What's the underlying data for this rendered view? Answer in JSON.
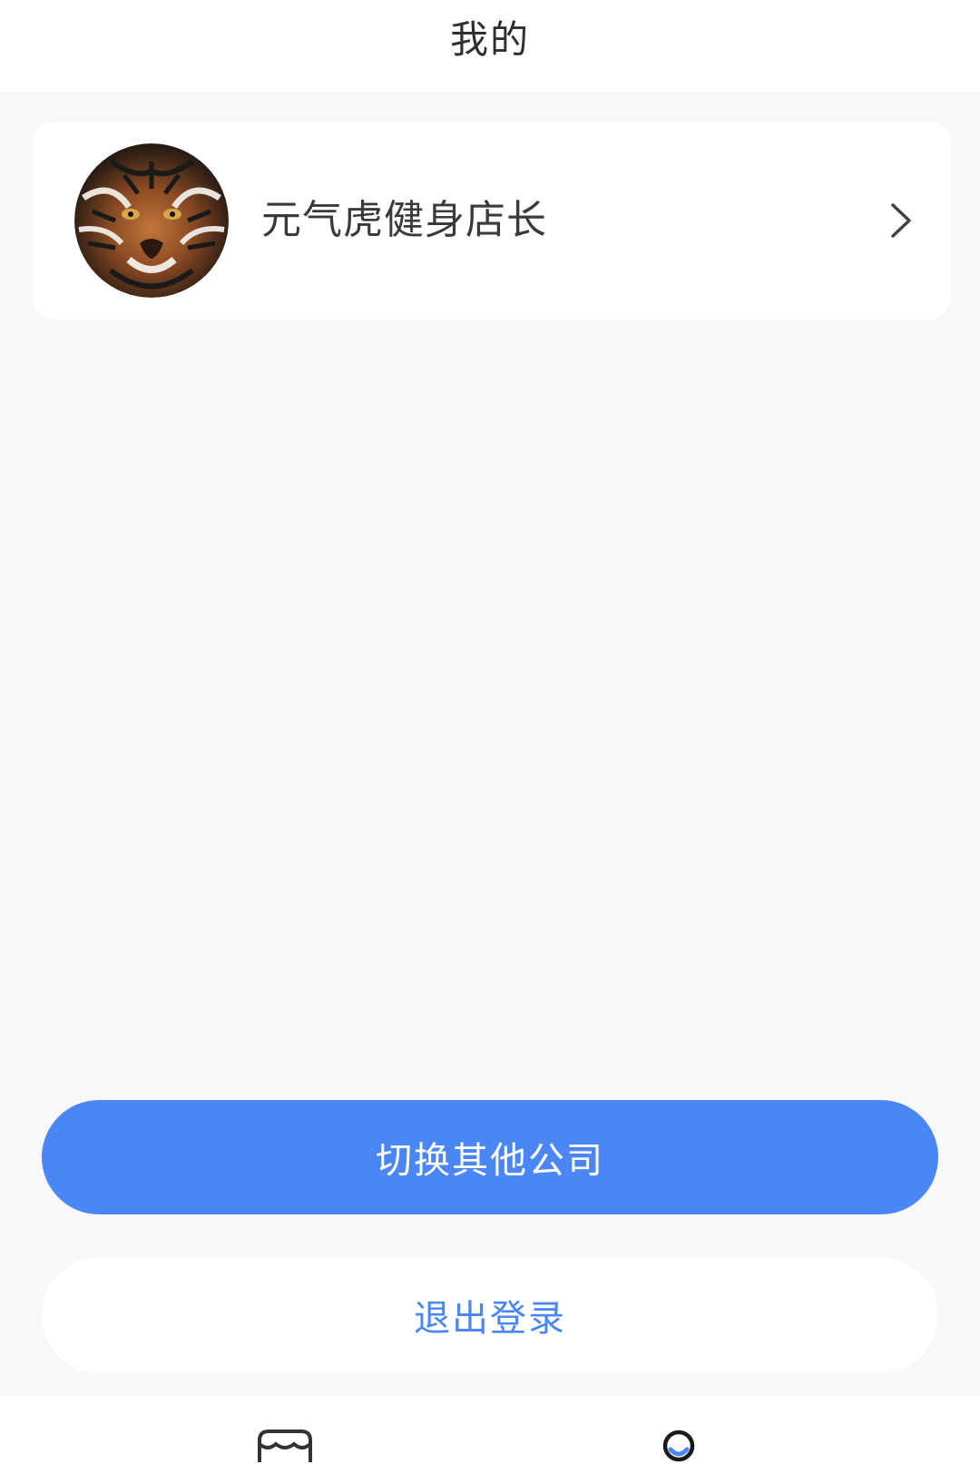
{
  "header": {
    "title": "我的"
  },
  "profile": {
    "name": "元气虎健身店长",
    "avatar_icon": "tiger-avatar",
    "chevron_icon": "chevron-right-icon"
  },
  "actions": {
    "switch_company": "切换其他公司",
    "logout": "退出登录"
  },
  "tabbar": {
    "items": [
      {
        "icon": "store-icon",
        "active": false
      },
      {
        "icon": "person-icon",
        "active": true
      }
    ]
  },
  "colors": {
    "accent": "#4a86f5",
    "background": "#f8f8f8",
    "card": "#ffffff",
    "text_primary": "#2f2f2f"
  }
}
